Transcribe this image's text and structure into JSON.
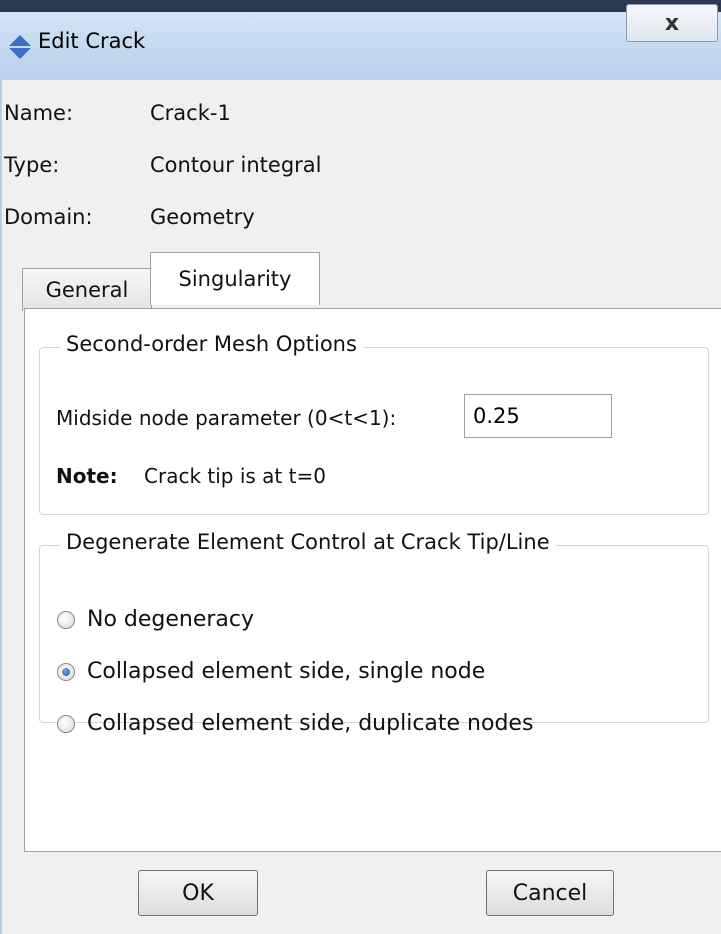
{
  "window": {
    "title": "Edit Crack",
    "close_label": "x"
  },
  "info": [
    {
      "label": "Name:",
      "value": "Crack-1"
    },
    {
      "label": "Type:",
      "value": "Contour integral"
    },
    {
      "label": "Domain:",
      "value": "Geometry"
    }
  ],
  "tabs": [
    {
      "label": "General",
      "active": false
    },
    {
      "label": "Singularity",
      "active": true
    }
  ],
  "mesh_options": {
    "title": "Second-order Mesh Options",
    "param_label": "Midside node parameter (0<t<1):",
    "param_value": "0.25",
    "note_label": "Note:",
    "note_text": "Crack tip is at t=0"
  },
  "degenerate": {
    "title": "Degenerate Element Control at Crack Tip/Line",
    "options": [
      {
        "label": "No degeneracy",
        "checked": false
      },
      {
        "label": "Collapsed element side, single node",
        "checked": true
      },
      {
        "label": "Collapsed element side, duplicate nodes",
        "checked": false
      }
    ]
  },
  "buttons": {
    "ok": "OK",
    "cancel": "Cancel"
  }
}
